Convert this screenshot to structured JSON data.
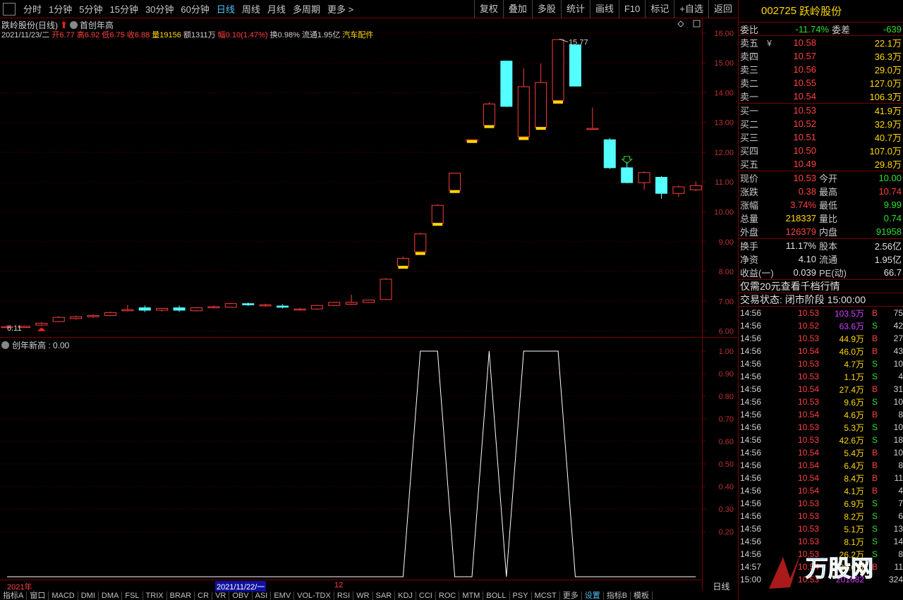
{
  "toolbar": {
    "periods": [
      "分时",
      "1分钟",
      "5分钟",
      "15分钟",
      "30分钟",
      "60分钟",
      "日线",
      "周线",
      "月线",
      "多周期",
      "更多 >"
    ],
    "active_period": "日线",
    "right_buttons": [
      "复权",
      "叠加",
      "多股",
      "统计",
      "画线",
      "F10",
      "标记",
      "+自选",
      "返回"
    ]
  },
  "stock": {
    "name_period": "跌岭股份(日线)",
    "indicator_tag": "首创年高",
    "date": "2021/11/23/二",
    "open_label": "开",
    "open": "6.77",
    "high_label": "高",
    "high": "6.92",
    "low_label": "低",
    "low": "6.75",
    "close_label": "收",
    "close": "6.88",
    "vol_label": "量",
    "vol": "19156",
    "amount_label": "额",
    "amount": "1311万",
    "change_label": "幅",
    "change": "0.10(1.47%)",
    "turnover": "换0.98%",
    "float": "流通1.95亿",
    "sector": "汽车配件"
  },
  "price_axis": [
    "16.00",
    "15.00",
    "14.00",
    "13.00",
    "12.00",
    "11.00",
    "10.00",
    "9.00",
    "8.00",
    "7.00",
    "6.00"
  ],
  "annotations": {
    "max": "15.77",
    "min": "6.11"
  },
  "indicator": {
    "title": "创年新高 : 0.00",
    "axis": [
      "1.00",
      "0.90",
      "0.80",
      "0.70",
      "0.60",
      "0.50",
      "0.40",
      "0.30",
      "0.20"
    ]
  },
  "x_axis": {
    "year": "2021年",
    "cursor_date": "2021/11/22/一",
    "month": "12",
    "right_label": "日线"
  },
  "chart_data": {
    "type": "candlestick",
    "ylim": [
      5.8,
      16.4
    ],
    "ohlc": [
      [
        6.15,
        6.2,
        6.1,
        6.15
      ],
      [
        6.12,
        6.18,
        6.11,
        6.16
      ],
      [
        6.2,
        6.3,
        6.16,
        6.26
      ],
      [
        6.32,
        6.5,
        6.3,
        6.46
      ],
      [
        6.42,
        6.52,
        6.38,
        6.48
      ],
      [
        6.48,
        6.56,
        6.44,
        6.52
      ],
      [
        6.52,
        6.66,
        6.5,
        6.62
      ],
      [
        6.68,
        6.88,
        6.66,
        6.72
      ],
      [
        6.78,
        6.86,
        6.64,
        6.7
      ],
      [
        6.7,
        6.78,
        6.66,
        6.76
      ],
      [
        6.78,
        6.86,
        6.64,
        6.7
      ],
      [
        6.68,
        6.8,
        6.66,
        6.78
      ],
      [
        6.78,
        6.86,
        6.76,
        6.82
      ],
      [
        6.8,
        6.94,
        6.78,
        6.92
      ],
      [
        6.92,
        6.96,
        6.84,
        6.88
      ],
      [
        6.86,
        6.92,
        6.82,
        6.88
      ],
      [
        6.84,
        6.9,
        6.76,
        6.8
      ],
      [
        6.72,
        6.78,
        6.68,
        6.74
      ],
      [
        6.74,
        6.88,
        6.72,
        6.86
      ],
      [
        6.86,
        6.98,
        6.84,
        6.96
      ],
      [
        6.9,
        7.22,
        6.88,
        6.96
      ],
      [
        6.96,
        7.04,
        6.94,
        7.04
      ],
      [
        7.06,
        7.78,
        7.04,
        7.74
      ],
      [
        8.18,
        8.5,
        8.14,
        8.44
      ],
      [
        8.66,
        9.3,
        8.6,
        9.26
      ],
      [
        9.62,
        10.26,
        9.58,
        10.22
      ],
      [
        10.72,
        11.3,
        10.68,
        11.3
      ],
      [
        12.36,
        12.44,
        12.36,
        12.42
      ],
      [
        12.9,
        13.68,
        12.86,
        13.62
      ],
      [
        15.06,
        15.08,
        13.52,
        13.54
      ],
      [
        12.52,
        14.82,
        12.46,
        14.2
      ],
      [
        12.84,
        14.98,
        12.8,
        14.34
      ],
      [
        13.74,
        15.8,
        13.68,
        15.78
      ],
      [
        15.6,
        15.62,
        14.22,
        14.22
      ],
      [
        12.8,
        13.5,
        12.78,
        12.8
      ],
      [
        12.42,
        12.48,
        11.44,
        11.48
      ],
      [
        11.48,
        11.68,
        10.96,
        10.98
      ],
      [
        10.98,
        11.36,
        10.74,
        11.32
      ],
      [
        11.16,
        11.2,
        10.44,
        10.62
      ],
      [
        10.62,
        10.88,
        10.5,
        10.84
      ],
      [
        10.74,
        11.02,
        10.7,
        10.88
      ]
    ],
    "indicator_values": [
      0,
      0,
      0,
      0,
      0,
      0,
      0,
      0,
      0,
      0,
      0,
      0,
      0,
      0,
      0,
      0,
      0,
      0,
      0,
      0,
      0,
      0,
      0,
      0,
      1,
      1,
      0,
      0,
      1,
      0,
      1,
      1,
      1,
      0,
      0,
      0,
      0,
      0,
      0,
      0,
      0
    ]
  },
  "right_panel": {
    "code": "002725",
    "name": "跃岭股份",
    "ratio": {
      "label": "委比",
      "value": "-11.74%",
      "label2": "委差",
      "value2": "-639"
    },
    "asks": [
      {
        "label": "卖五",
        "mark": "￥",
        "price": "10.58",
        "vol": "22.1万"
      },
      {
        "label": "卖四",
        "price": "10.57",
        "vol": "36.3万"
      },
      {
        "label": "卖三",
        "price": "10.56",
        "vol": "29.0万"
      },
      {
        "label": "卖二",
        "price": "10.55",
        "vol": "127.0万"
      },
      {
        "label": "卖一",
        "price": "10.54",
        "vol": "106.3万"
      }
    ],
    "bids": [
      {
        "label": "买一",
        "price": "10.53",
        "vol": "41.9万"
      },
      {
        "label": "买二",
        "price": "10.52",
        "vol": "32.9万"
      },
      {
        "label": "买三",
        "price": "10.51",
        "vol": "40.7万"
      },
      {
        "label": "买四",
        "price": "10.50",
        "vol": "107.0万"
      },
      {
        "label": "买五",
        "price": "10.49",
        "vol": "29.8万"
      }
    ],
    "quote": [
      {
        "l1": "现价",
        "v1": "10.53",
        "c1": "r",
        "l2": "今开",
        "v2": "10.00",
        "c2": "g"
      },
      {
        "l1": "涨跌",
        "v1": "0.38",
        "c1": "r",
        "l2": "最高",
        "v2": "10.74",
        "c2": "r"
      },
      {
        "l1": "涨幅",
        "v1": "3.74%",
        "c1": "r",
        "l2": "最低",
        "v2": "9.99",
        "c2": "g"
      },
      {
        "l1": "总量",
        "v1": "218337",
        "c1": "y",
        "l2": "量比",
        "v2": "0.74",
        "c2": "g"
      },
      {
        "l1": "外盘",
        "v1": "126379",
        "c1": "r",
        "l2": "内盘",
        "v2": "91958",
        "c2": "g"
      }
    ],
    "fund": [
      {
        "l1": "换手",
        "v1": "11.17%",
        "l2": "股本",
        "v2": "2.56亿"
      },
      {
        "l1": "净资",
        "v1": "4.10",
        "l2": "流通",
        "v2": "1.95亿"
      },
      {
        "l1": "收益(一)",
        "v1": "0.039",
        "l2": "PE(动)",
        "v2": "66.7"
      }
    ],
    "promo": "仅需20元查看千档行情",
    "status": "交易状态: 闭市阶段 15:00:00",
    "ticks": [
      {
        "t": "14:56",
        "p": "10.53",
        "pc": "r",
        "v": "103.5万",
        "vc": "m",
        "bs": "B",
        "n": "75"
      },
      {
        "t": "14:56",
        "p": "10.52",
        "pc": "r",
        "v": "63.6万",
        "vc": "m",
        "bs": "S",
        "n": "42"
      },
      {
        "t": "14:56",
        "p": "10.53",
        "pc": "r",
        "v": "44.9万",
        "vc": "y",
        "bs": "B",
        "n": "27"
      },
      {
        "t": "14:56",
        "p": "10.54",
        "pc": "r",
        "v": "46.0万",
        "vc": "y",
        "bs": "B",
        "n": "43"
      },
      {
        "t": "14:56",
        "p": "10.53",
        "pc": "r",
        "v": "4.7万",
        "vc": "y",
        "bs": "S",
        "n": "10"
      },
      {
        "t": "14:56",
        "p": "10.53",
        "pc": "r",
        "v": "1.1万",
        "vc": "y",
        "bs": "S",
        "n": "4"
      },
      {
        "t": "14:56",
        "p": "10.54",
        "pc": "r",
        "v": "27.4万",
        "vc": "y",
        "bs": "B",
        "n": "31"
      },
      {
        "t": "14:56",
        "p": "10.53",
        "pc": "r",
        "v": "9.6万",
        "vc": "y",
        "bs": "S",
        "n": "10"
      },
      {
        "t": "14:56",
        "p": "10.54",
        "pc": "r",
        "v": "4.6万",
        "vc": "y",
        "bs": "B",
        "n": "8"
      },
      {
        "t": "14:56",
        "p": "10.53",
        "pc": "r",
        "v": "5.3万",
        "vc": "y",
        "bs": "S",
        "n": "10"
      },
      {
        "t": "14:56",
        "p": "10.53",
        "pc": "r",
        "v": "42.6万",
        "vc": "y",
        "bs": "S",
        "n": "18"
      },
      {
        "t": "14:56",
        "p": "10.54",
        "pc": "r",
        "v": "5.4万",
        "vc": "y",
        "bs": "B",
        "n": "10"
      },
      {
        "t": "14:56",
        "p": "10.54",
        "pc": "r",
        "v": "6.4万",
        "vc": "y",
        "bs": "B",
        "n": "8"
      },
      {
        "t": "14:56",
        "p": "10.54",
        "pc": "r",
        "v": "8.4万",
        "vc": "y",
        "bs": "B",
        "n": "11"
      },
      {
        "t": "14:56",
        "p": "10.54",
        "pc": "r",
        "v": "4.1万",
        "vc": "y",
        "bs": "B",
        "n": "4"
      },
      {
        "t": "14:56",
        "p": "10.53",
        "pc": "r",
        "v": "6.9万",
        "vc": "y",
        "bs": "S",
        "n": "7"
      },
      {
        "t": "14:56",
        "p": "10.53",
        "pc": "r",
        "v": "8.2万",
        "vc": "y",
        "bs": "S",
        "n": "6"
      },
      {
        "t": "14:56",
        "p": "10.53",
        "pc": "r",
        "v": "5.1万",
        "vc": "y",
        "bs": "S",
        "n": "13"
      },
      {
        "t": "14:56",
        "p": "10.53",
        "pc": "r",
        "v": "8.1万",
        "vc": "y",
        "bs": "S",
        "n": "14"
      },
      {
        "t": "14:56",
        "p": "10.53",
        "pc": "r",
        "v": "26.2万",
        "vc": "y",
        "bs": "S",
        "n": "8"
      },
      {
        "t": "14:57",
        "p": "10.54",
        "pc": "r",
        "v": "28.0万",
        "vc": "y",
        "bs": "B",
        "n": "11"
      },
      {
        "t": "15:00",
        "p": "10.53",
        "pc": "r",
        "v": "201682",
        "vc": "m",
        "bs": "",
        "n": "324"
      }
    ]
  },
  "bottom_tabs": [
    "指标A",
    "窗口",
    "MACD",
    "DMI",
    "DMA",
    "FSL",
    "TRIX",
    "BRAR",
    "CR",
    "VR",
    "OBV",
    "ASI",
    "EMV",
    "VOL-TDX",
    "RSI",
    "WR",
    "SAR",
    "KDJ",
    "CCI",
    "ROC",
    "MTM",
    "BOLL",
    "PSY",
    "MCST",
    "更多",
    "设置",
    "指标B",
    "模板"
  ],
  "watermark": "万股网",
  "colors": {
    "up": "#ff3c3c",
    "down": "#54ffff",
    "bg": "#000000",
    "grid": "#7a0000",
    "text_up": "#ff4040",
    "text_down": "#2ee02e",
    "gold": "#ffd800"
  }
}
